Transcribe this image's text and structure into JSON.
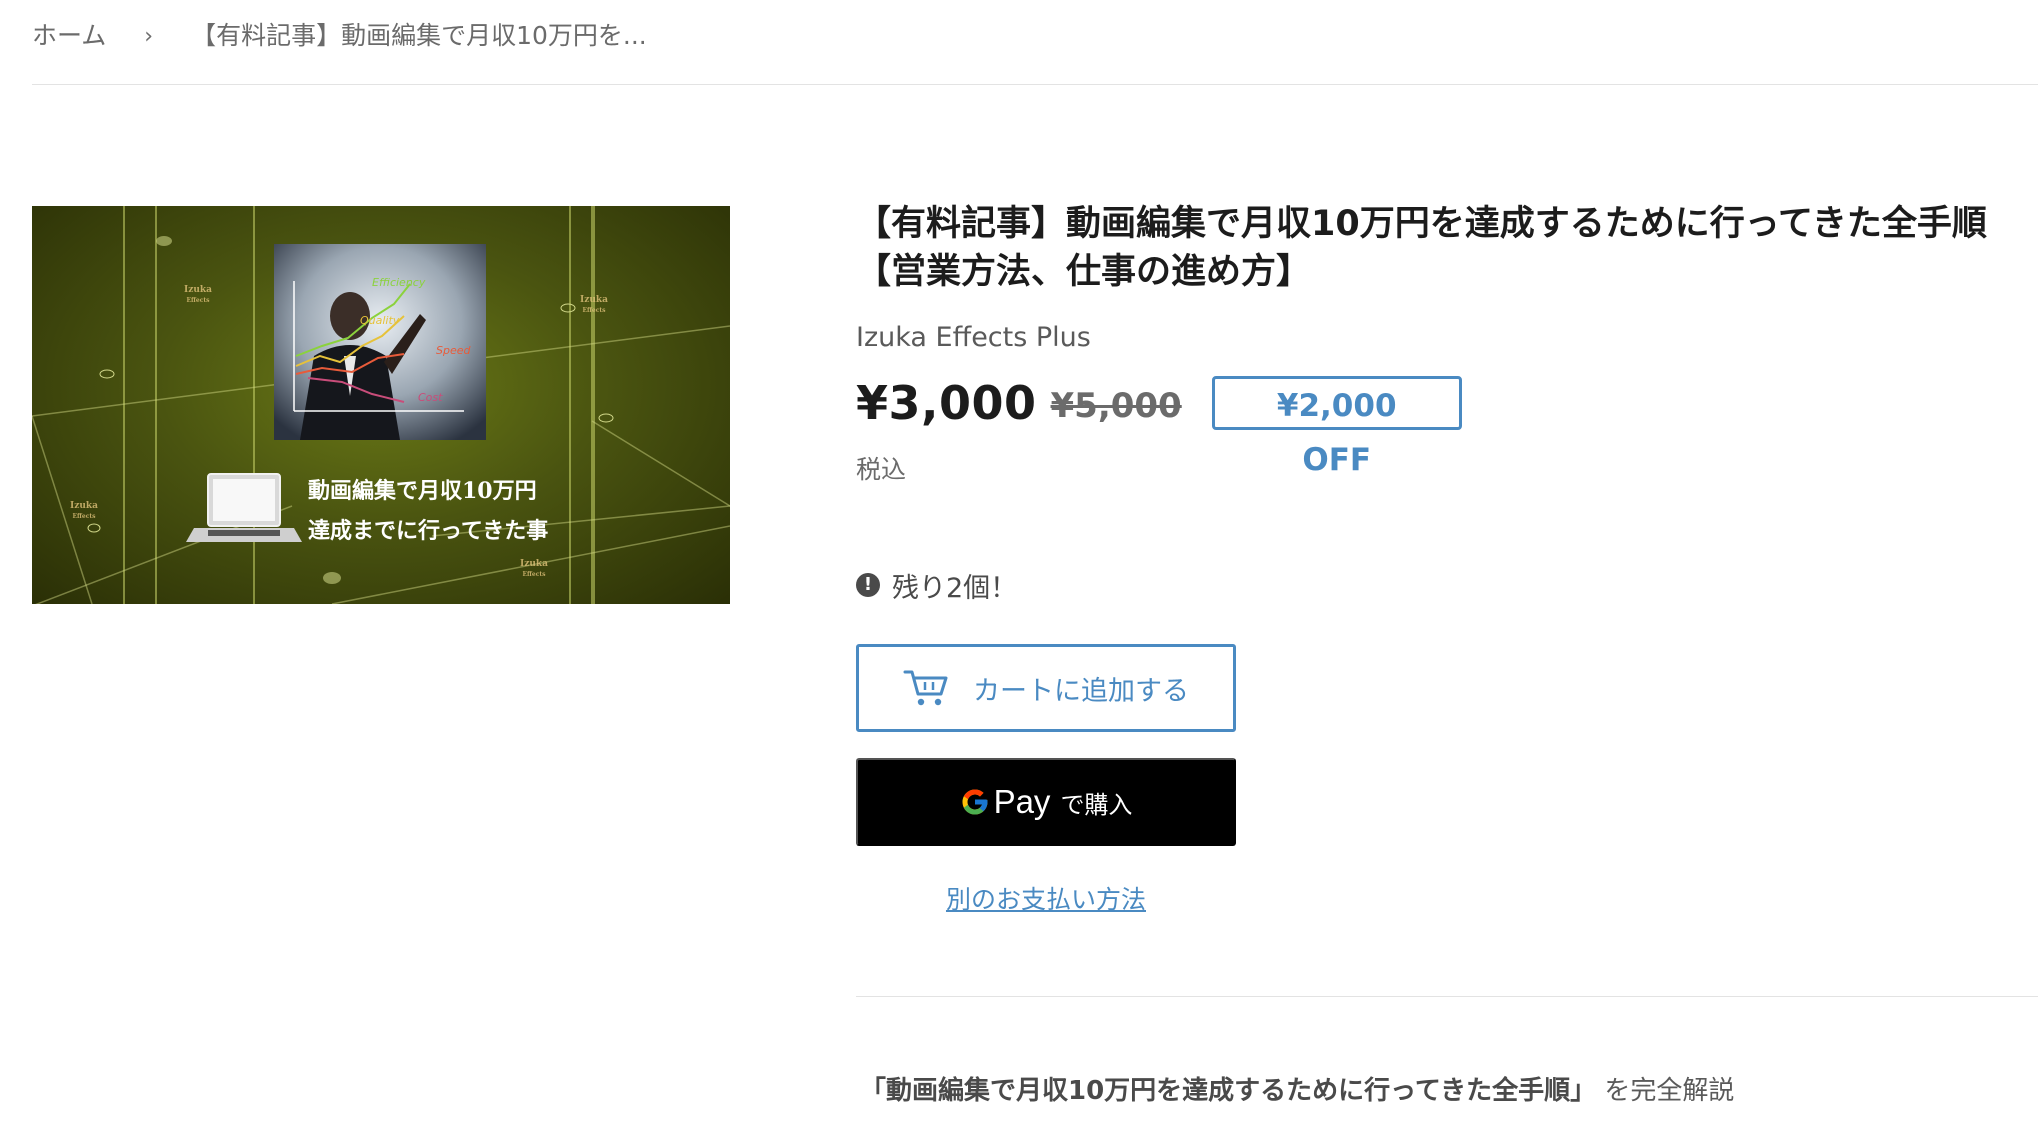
{
  "breadcrumb": {
    "home": "ホーム",
    "separator": "›",
    "current": "【有料記事】動画編集で月収10万円を..."
  },
  "product": {
    "title_line1": "【有料記事】動画編集で月収10万円を達成するために行ってきた全手順",
    "title_line2": "【営業方法、仕事の進め方】",
    "vendor": "Izuka Effects Plus",
    "price": "¥3,000",
    "compare_price": "¥5,000",
    "discount_badge": "¥2,000 OFF",
    "tax_note": "税込",
    "stock_message": "残り2個！",
    "add_to_cart": "カートに追加する",
    "gpay_label": "Pay",
    "gpay_suffix": "で購入",
    "more_payment": "別のお支払い方法",
    "description_strong": "「動画編集で月収10万円を達成するために行ってきた全手順」",
    "description_rest": "を完全解説"
  },
  "thumbnail": {
    "chart_labels": {
      "efficiency": "Efficiency",
      "quality": "Quality",
      "speed": "Speed",
      "cost": "Cost"
    },
    "caption_line1": "動画編集で月収10万円",
    "caption_line2": "達成までに行ってきた事",
    "watermark_top": "Izuka",
    "watermark_bottom": "Effects"
  },
  "colors": {
    "accent": "#4a8ac2",
    "text_dark": "#1c1c1c",
    "text_muted": "#6b6b6b",
    "gpay_bg": "#000000"
  },
  "icons": {
    "stock": "exclamation-circle-icon",
    "cart": "cart-icon",
    "google": "google-g-icon"
  }
}
